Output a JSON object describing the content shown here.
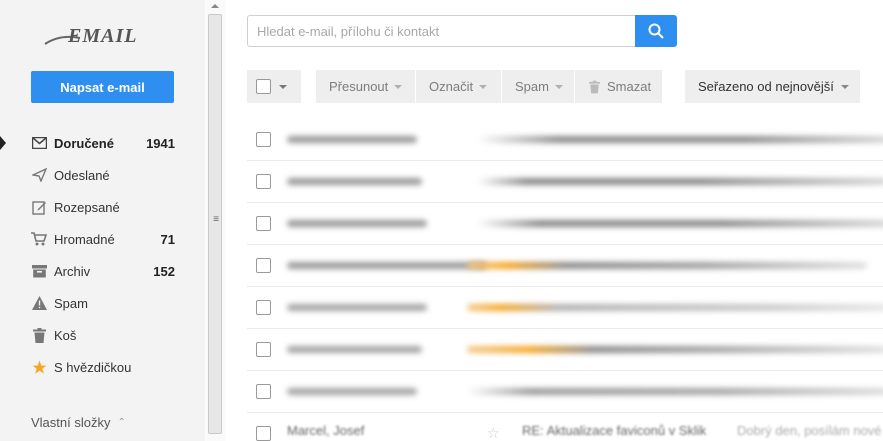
{
  "app": {
    "logo_text": "EMAIL",
    "compose_label": "Napsat e-mail"
  },
  "sidebar": {
    "items": [
      {
        "label": "Doručené",
        "count": "1941",
        "icon": "envelope-icon",
        "active": true
      },
      {
        "label": "Odeslané",
        "count": "",
        "icon": "send-icon"
      },
      {
        "label": "Rozepsané",
        "count": "",
        "icon": "draft-edit-icon"
      },
      {
        "label": "Hromadné",
        "count": "71",
        "icon": "cart-icon"
      },
      {
        "label": "Archiv",
        "count": "152",
        "icon": "archive-icon"
      },
      {
        "label": "Spam",
        "count": "",
        "icon": "warning-icon"
      },
      {
        "label": "Koš",
        "count": "",
        "icon": "trash-icon"
      },
      {
        "label": "S hvězdičkou",
        "count": "",
        "icon": "star-icon"
      }
    ],
    "custom_folders_label": "Vlastní složky"
  },
  "search": {
    "placeholder": "Hledat e-mail, přílohu či kontakt"
  },
  "toolbar": {
    "move_label": "Přesunout",
    "mark_label": "Označit",
    "spam_label": "Spam",
    "delete_label": "Smazat",
    "sort_label": "Seřazeno od nejnovější"
  },
  "colors": {
    "accent": "#2f8ff0",
    "star": "#f5a623",
    "sidebar_bg": "#f3f3f3"
  },
  "messages": {
    "partial_row": {
      "sender": "Marcel, Josef",
      "subject": "RE: Aktualizace faviconů v Sklik",
      "preview": "Dobrý den, posílám nové"
    }
  }
}
